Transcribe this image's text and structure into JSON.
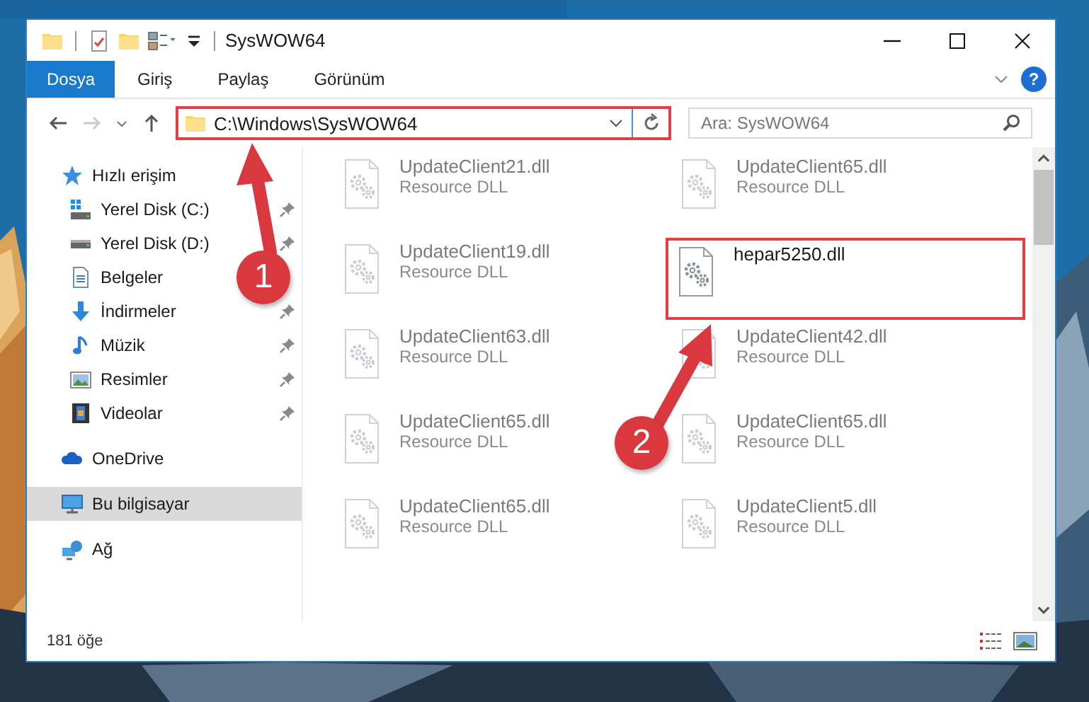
{
  "window": {
    "title": "SysWOW64"
  },
  "ribbon_tabs": [
    {
      "label": "Dosya",
      "selected": true
    },
    {
      "label": "Giriş",
      "selected": false
    },
    {
      "label": "Paylaş",
      "selected": false
    },
    {
      "label": "Görünüm",
      "selected": false
    }
  ],
  "address": {
    "path": "C:\\Windows\\SysWOW64",
    "outlined": true
  },
  "help": {
    "label": "?"
  },
  "search": {
    "placeholder": "Ara: SysWOW64"
  },
  "sidebar": {
    "items": [
      {
        "label": "Hızlı erişim",
        "kind": "star",
        "selected": false,
        "children": [
          {
            "label": "Yerel Disk (C:)",
            "kind": "drive-c",
            "pinned": true,
            "selected": false
          },
          {
            "label": "Yerel Disk (D:)",
            "kind": "drive",
            "pinned": true,
            "selected": false
          },
          {
            "label": "Belgeler",
            "kind": "documents",
            "pinned": false,
            "selected": false
          },
          {
            "label": "İndirmeler",
            "kind": "downloads",
            "pinned": true,
            "selected": false
          },
          {
            "label": "Müzik",
            "kind": "music",
            "pinned": true,
            "selected": false
          },
          {
            "label": "Resimler",
            "kind": "pictures",
            "pinned": true,
            "selected": false
          },
          {
            "label": "Videolar",
            "kind": "videos",
            "pinned": true,
            "selected": false
          }
        ]
      },
      {
        "label": "OneDrive",
        "kind": "cloud",
        "selected": false
      },
      {
        "label": "Bu bilgisayar",
        "kind": "computer",
        "selected": true
      },
      {
        "label": "Ağ",
        "kind": "network",
        "selected": false
      }
    ]
  },
  "files": [
    {
      "name": "UpdateClient21.dll",
      "subtitle": "Resource DLL",
      "blurred": true,
      "outlined": false
    },
    {
      "name": "UpdateClient65.dll",
      "subtitle": "Resource DLL",
      "blurred": true,
      "outlined": false
    },
    {
      "name": "UpdateClient19.dll",
      "subtitle": "Resource DLL",
      "blurred": true,
      "outlined": false
    },
    {
      "name": "hepar5250.dll",
      "blurred": false,
      "outlined": true
    },
    {
      "name": "UpdateClient63.dll",
      "subtitle": "Resource DLL",
      "blurred": true,
      "outlined": false
    },
    {
      "name": "UpdateClient42.dll",
      "subtitle": "Resource DLL",
      "blurred": true,
      "outlined": false
    },
    {
      "name": "UpdateClient65.dll",
      "subtitle": "Resource DLL",
      "blurred": true,
      "outlined": false
    },
    {
      "name": "UpdateClient65.dll",
      "subtitle": "Resource DLL",
      "blurred": true,
      "outlined": false
    },
    {
      "name": "UpdateClient65.dll",
      "subtitle": "Resource DLL",
      "blurred": true,
      "outlined": false
    },
    {
      "name": "UpdateClient5.dll",
      "subtitle": "Resource DLL",
      "blurred": true,
      "outlined": false
    }
  ],
  "status_bar": {
    "item_count": "181 öğe"
  },
  "callouts": [
    {
      "number": "1"
    },
    {
      "number": "2"
    }
  ]
}
